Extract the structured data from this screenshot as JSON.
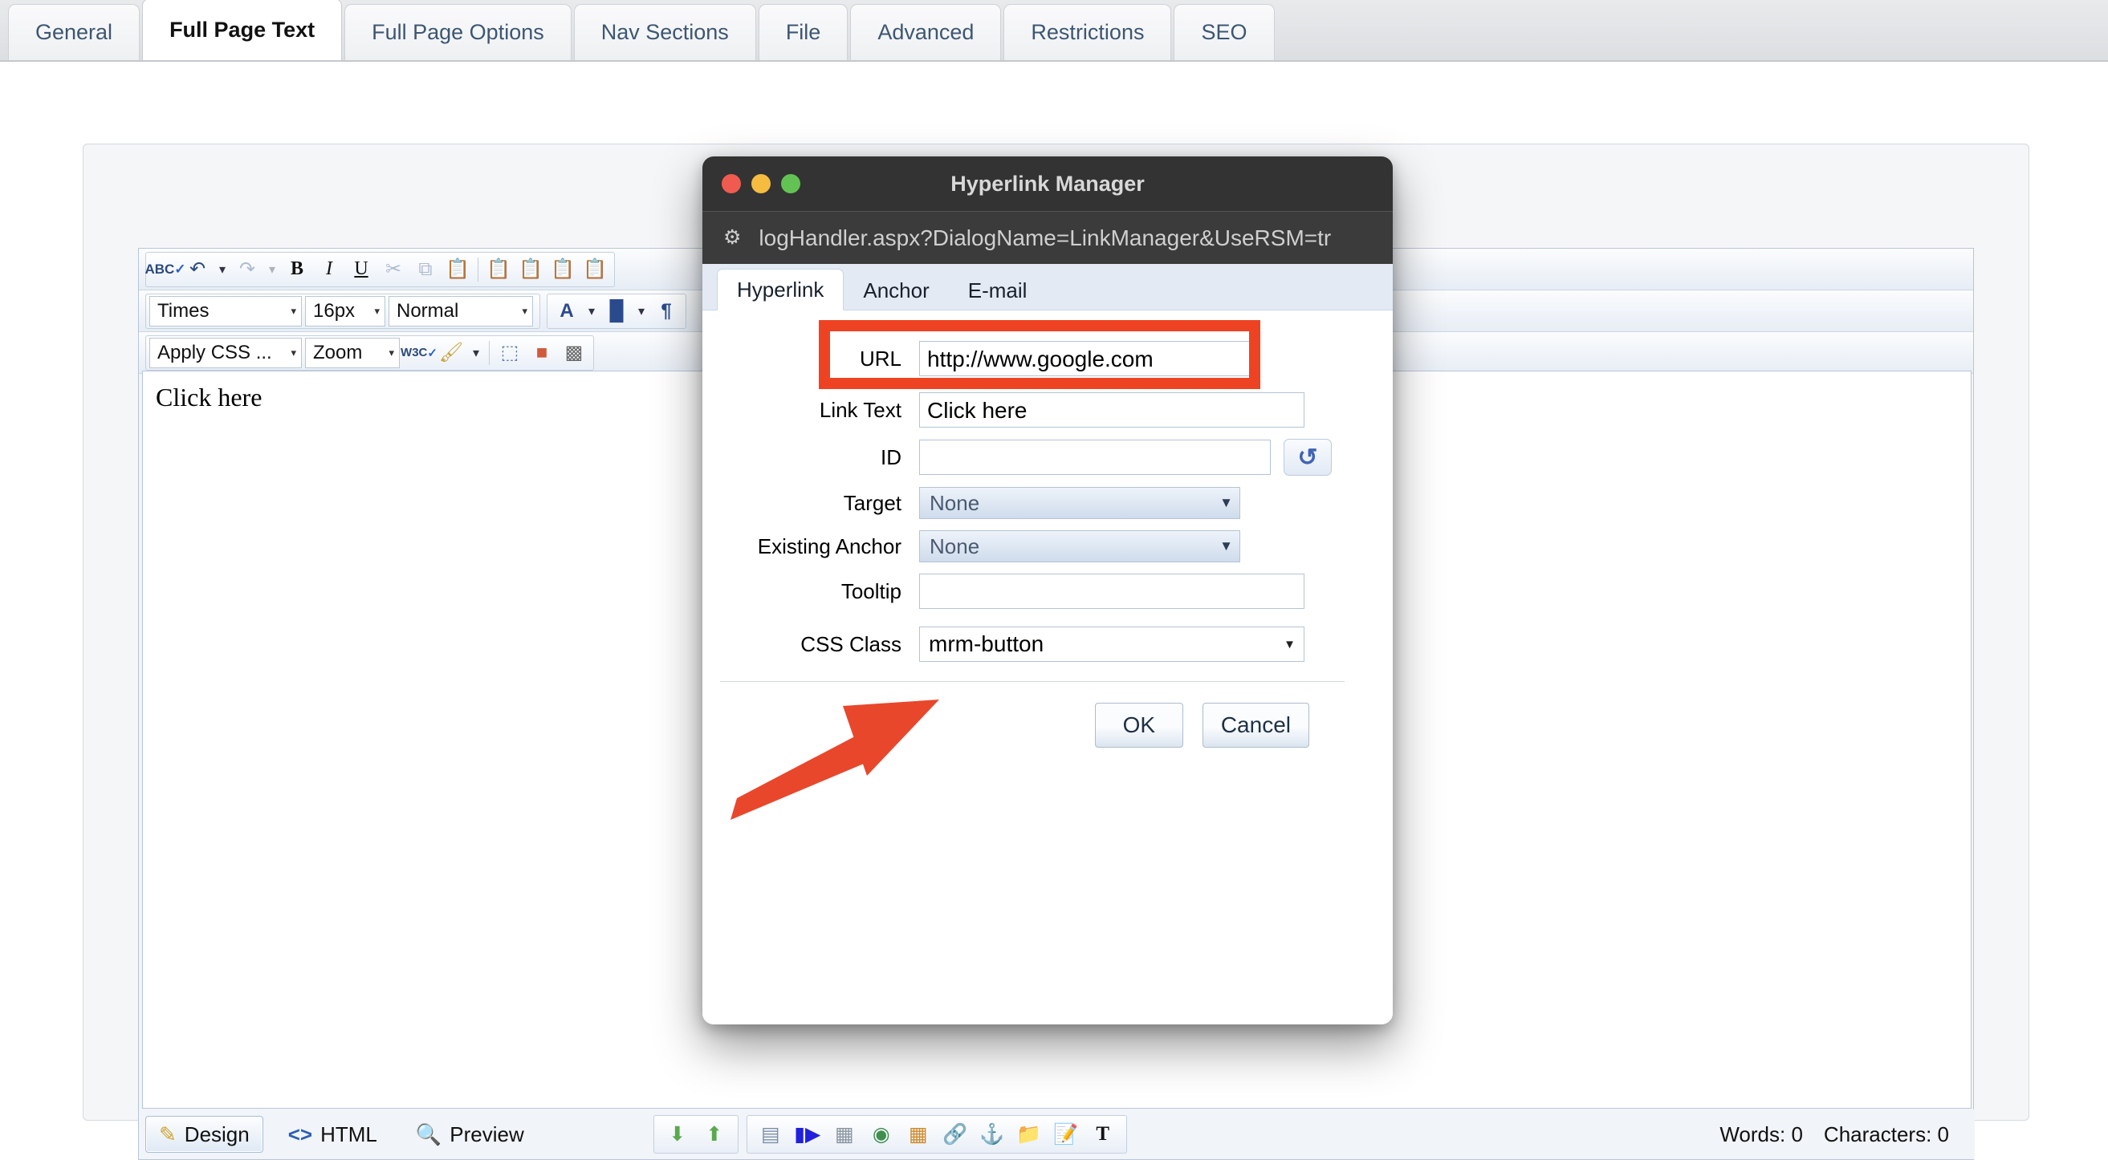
{
  "top_tabs": [
    {
      "label": "General",
      "active": false
    },
    {
      "label": "Full Page Text",
      "active": true
    },
    {
      "label": "Full Page Options",
      "active": false
    },
    {
      "label": "Nav Sections",
      "active": false
    },
    {
      "label": "File",
      "active": false
    },
    {
      "label": "Advanced",
      "active": false
    },
    {
      "label": "Restrictions",
      "active": false
    },
    {
      "label": "SEO",
      "active": false
    }
  ],
  "editor": {
    "toolbar_row1": [
      {
        "name": "spellcheck-icon",
        "glyph": "ABC"
      },
      {
        "name": "undo-icon",
        "glyph": "↶"
      },
      {
        "name": "undo-dropdown-icon",
        "glyph": "▾"
      },
      {
        "name": "redo-icon",
        "glyph": "↷"
      },
      {
        "name": "redo-dropdown-icon",
        "glyph": "▾"
      },
      {
        "name": "bold-icon",
        "glyph": "B"
      },
      {
        "name": "italic-icon",
        "glyph": "I"
      },
      {
        "name": "underline-icon",
        "glyph": "U"
      },
      {
        "name": "cut-icon",
        "glyph": "✂"
      },
      {
        "name": "copy-icon",
        "glyph": "⧉"
      },
      {
        "name": "paste-icon",
        "glyph": "📋"
      },
      {
        "name": "paste-from-word-icon",
        "glyph": "W"
      },
      {
        "name": "paste-from-word-strip-icon",
        "glyph": "W"
      },
      {
        "name": "paste-plain-text-icon",
        "glyph": "📄"
      },
      {
        "name": "paste-as-html-icon",
        "glyph": "<>"
      }
    ],
    "font_name": "Times",
    "font_size": "16px",
    "paragraph_style": "Normal",
    "foreground_color_icon": "A",
    "background_color_icon": "🪣",
    "format_paragraph_icon": "¶",
    "apply_css_class": "Apply CSS ...",
    "zoom": "Zoom",
    "w3c_validate_icon": "W3C",
    "format_stripper_icon": "🖌",
    "module_manager_icon": "⬚",
    "template_icon": "📑",
    "ajax_spellcheck_icon": "🎴",
    "content": "Click here",
    "modes": [
      {
        "label": "Design",
        "icon": "pencil-icon",
        "glyph": "✎",
        "selected": true
      },
      {
        "label": "HTML",
        "icon": "code-icon",
        "glyph": "<>",
        "selected": false
      },
      {
        "label": "Preview",
        "icon": "magnifier-icon",
        "glyph": "🔍",
        "selected": false
      }
    ],
    "bottom_tools_group1": [
      {
        "name": "move-down-icon",
        "glyph": "↓"
      },
      {
        "name": "move-up-icon",
        "glyph": "↑"
      }
    ],
    "bottom_tools_group2": [
      {
        "name": "insert-table-icon",
        "glyph": "▤"
      },
      {
        "name": "insert-video-icon",
        "glyph": "📹"
      },
      {
        "name": "image-manager-icon",
        "glyph": "🖼"
      },
      {
        "name": "document-manager-icon",
        "glyph": "🌐"
      },
      {
        "name": "flash-manager-icon",
        "glyph": "▦"
      },
      {
        "name": "link-manager-icon",
        "glyph": "🔗"
      },
      {
        "name": "anchor-icon",
        "glyph": "☈"
      },
      {
        "name": "media-folder-icon",
        "glyph": "📁"
      },
      {
        "name": "edit-document-icon",
        "glyph": "📝"
      },
      {
        "name": "format-text-icon",
        "glyph": "T"
      }
    ],
    "words_label": "Words: 0",
    "characters_label": "Characters: 0"
  },
  "dialog": {
    "window_title": "Hyperlink Manager",
    "url_bar": "logHandler.aspx?DialogName=LinkManager&UseRSM=tr",
    "url_bar_icon": "page-settings-icon",
    "traffic_lights": [
      "close",
      "minimize",
      "zoom"
    ],
    "tabs": [
      {
        "label": "Hyperlink",
        "active": true
      },
      {
        "label": "Anchor",
        "active": false
      },
      {
        "label": "E-mail",
        "active": false
      }
    ],
    "fields": {
      "url_label": "URL",
      "url_value": "http://www.google.com",
      "link_text_label": "Link Text",
      "link_text_value": "Click here",
      "id_label": "ID",
      "id_value": "",
      "id_refresh_icon": "↺",
      "target_label": "Target",
      "target_value": "None",
      "existing_anchor_label": "Existing Anchor",
      "existing_anchor_value": "None",
      "tooltip_label": "Tooltip",
      "tooltip_value": "",
      "css_class_label": "CSS Class",
      "css_class_value": "mrm-button"
    },
    "buttons": {
      "ok": "OK",
      "cancel": "Cancel"
    }
  },
  "annotation": {
    "highlight_color": "#ee4323",
    "arrow_color": "#e8472c",
    "target": "css-class-dropdown"
  }
}
